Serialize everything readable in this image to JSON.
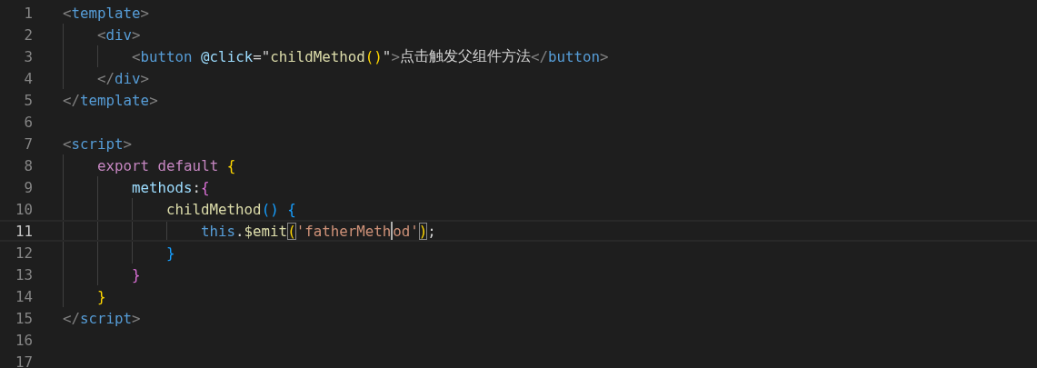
{
  "lines": [
    {
      "number": "1",
      "selected": false,
      "tokens": [
        {
          "text": "<",
          "kind": "punct"
        },
        {
          "text": "template",
          "kind": "tag"
        },
        {
          "text": ">",
          "kind": "punct"
        }
      ],
      "children": [
        {
          "number": "2",
          "selected": false,
          "tokens": [
            {
              "text": "<",
              "kind": "punct"
            },
            {
              "text": "div",
              "kind": "tag"
            },
            {
              "text": ">",
              "kind": "punct"
            }
          ],
          "children": [
            {
              "number": "3",
              "selected": false,
              "tokens": [
                {
                  "text": "<",
                  "kind": "punct"
                },
                {
                  "text": "button ",
                  "kind": "tag"
                },
                {
                  "text": "@click",
                  "kind": "attr"
                },
                {
                  "text": "=\"",
                  "kind": "plain"
                },
                {
                  "text": "childMethod",
                  "kind": "func"
                },
                {
                  "text": "()",
                  "kind": "bracket1"
                },
                {
                  "text": "\"",
                  "kind": "plain"
                },
                {
                  "text": ">",
                  "kind": "punct"
                },
                {
                  "text": "点击触发父组件方法",
                  "kind": "plain"
                },
                {
                  "text": "</",
                  "kind": "punct"
                },
                {
                  "text": "button",
                  "kind": "tag"
                },
                {
                  "text": ">",
                  "kind": "punct"
                }
              ]
            }
          ]
        },
        {
          "number": "4",
          "selected": false,
          "tokens": [
            {
              "text": "</",
              "kind": "punct"
            },
            {
              "text": "div",
              "kind": "tag"
            },
            {
              "text": ">",
              "kind": "punct"
            }
          ]
        }
      ]
    },
    {
      "number": "5",
      "selected": false,
      "tokens": [
        {
          "text": "</",
          "kind": "punct"
        },
        {
          "text": "template",
          "kind": "tag"
        },
        {
          "text": ">",
          "kind": "punct"
        }
      ]
    },
    {
      "number": "6",
      "selected": false
    },
    {
      "number": "7",
      "selected": false,
      "tokens": [
        {
          "text": "<",
          "kind": "punct"
        },
        {
          "text": "script",
          "kind": "tag"
        },
        {
          "text": ">",
          "kind": "punct"
        }
      ],
      "children": [
        {
          "number": "8",
          "selected": false,
          "tokens": [
            {
              "text": "export ",
              "kind": "keyword"
            },
            {
              "text": "default ",
              "kind": "keyword"
            },
            {
              "text": "{",
              "kind": "bracket1"
            }
          ],
          "children": [
            {
              "number": "9",
              "selected": false,
              "tokens": [
                {
                  "text": "methods",
                  "kind": "attr"
                },
                {
                  "text": ":",
                  "kind": "plain"
                },
                {
                  "text": "{",
                  "kind": "bracket2"
                }
              ],
              "children": [
                {
                  "number": "10",
                  "selected": false,
                  "tokens": [
                    {
                      "text": "childMethod",
                      "kind": "func"
                    },
                    {
                      "text": "() {",
                      "kind": "bracket3"
                    }
                  ],
                  "children": [
                    {
                      "number": "11",
                      "selected": true,
                      "tokens": [
                        {
                          "text": "this",
                          "kind": "tag"
                        },
                        {
                          "text": ".",
                          "kind": "plain"
                        },
                        {
                          "text": "$emit",
                          "kind": "func"
                        },
                        {
                          "text": "(",
                          "kind": "bracket-match"
                        },
                        {
                          "text": "'fatherMeth",
                          "kind": "string",
                          "caret": true
                        },
                        {
                          "text": "od'",
                          "kind": "string"
                        },
                        {
                          "text": ")",
                          "kind": "bracket-match"
                        },
                        {
                          "text": ";",
                          "kind": "plain"
                        }
                      ]
                    }
                  ]
                },
                {
                  "number": "12",
                  "selected": false,
                  "tokens": [
                    {
                      "text": "}",
                      "kind": "bracket3"
                    }
                  ]
                }
              ]
            },
            {
              "number": "13",
              "selected": false,
              "tokens": [
                {
                  "text": "}",
                  "kind": "bracket2"
                }
              ]
            }
          ]
        },
        {
          "number": "14",
          "selected": false,
          "tokens": [
            {
              "text": "}",
              "kind": "bracket1"
            }
          ]
        }
      ]
    },
    {
      "number": "15",
      "selected": false,
      "tokens": [
        {
          "text": "</",
          "kind": "punct"
        },
        {
          "text": "script",
          "kind": "tag"
        },
        {
          "text": ">",
          "kind": "punct"
        }
      ]
    },
    {
      "number": "16",
      "selected": false
    },
    {
      "number": "17",
      "selected": false
    }
  ]
}
